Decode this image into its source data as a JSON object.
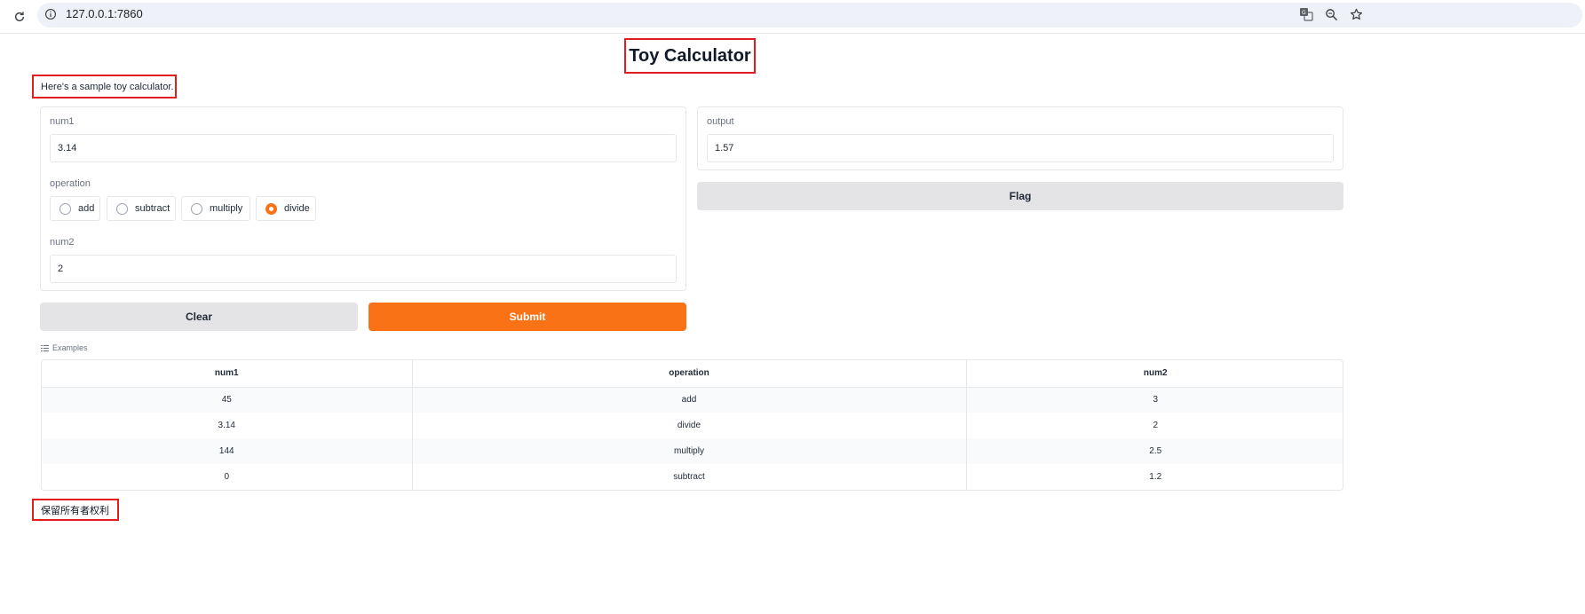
{
  "browser": {
    "url": "127.0.0.1:7860",
    "icons": [
      "reload-icon",
      "site-info-icon",
      "translate-icon",
      "zoom-icon",
      "bookmark-star-icon"
    ]
  },
  "page": {
    "title": "Toy Calculator",
    "description": "Here's a sample toy calculator."
  },
  "inputs": {
    "num1": {
      "label": "num1",
      "value": "3.14"
    },
    "operation": {
      "label": "operation",
      "options": [
        "add",
        "subtract",
        "multiply",
        "divide"
      ],
      "selected": "divide"
    },
    "num2": {
      "label": "num2",
      "value": "2"
    }
  },
  "outputs": {
    "output": {
      "label": "output",
      "value": "1.57"
    }
  },
  "buttons": {
    "flag": "Flag",
    "clear": "Clear",
    "submit": "Submit"
  },
  "examples": {
    "label": "Examples",
    "headers": [
      "num1",
      "operation",
      "num2"
    ],
    "rows": [
      [
        "45",
        "add",
        "3"
      ],
      [
        "3.14",
        "divide",
        "2"
      ],
      [
        "144",
        "multiply",
        "2.5"
      ],
      [
        "0",
        "subtract",
        "1.2"
      ]
    ]
  },
  "footer": {
    "text": "保留所有者权利"
  },
  "colors": {
    "accent": "#f97316",
    "highlight_border": "#e11d1d",
    "button_gray": "#e4e4e7"
  }
}
